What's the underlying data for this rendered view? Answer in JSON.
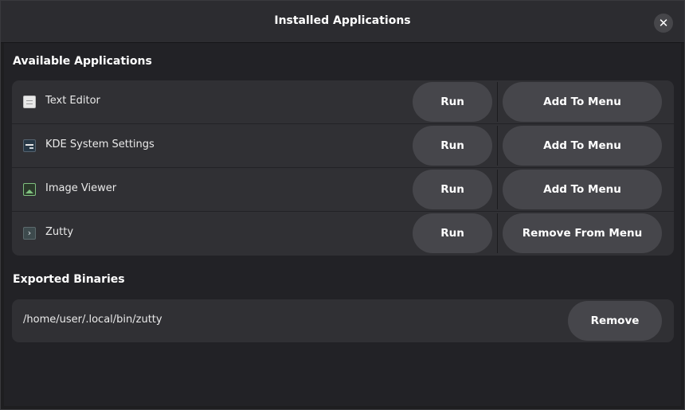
{
  "window": {
    "title": "Installed Applications",
    "close_label": "✕"
  },
  "available": {
    "heading": "Available Applications",
    "apps": [
      {
        "name": "Text Editor",
        "icon": "text-editor-icon",
        "run_label": "Run",
        "menu_label": "Add To Menu"
      },
      {
        "name": "KDE System Settings",
        "icon": "kde-settings-icon",
        "run_label": "Run",
        "menu_label": "Add To Menu"
      },
      {
        "name": "Image Viewer",
        "icon": "image-viewer-icon",
        "run_label": "Run",
        "menu_label": "Add To Menu"
      },
      {
        "name": "Zutty",
        "icon": "terminal-icon",
        "icon_glyph": "›",
        "run_label": "Run",
        "menu_label": "Remove From Menu"
      }
    ]
  },
  "binaries": {
    "heading": "Exported Binaries",
    "items": [
      {
        "path": "/home/user/.local/bin/zutty",
        "remove_label": "Remove"
      }
    ]
  },
  "colors": {
    "background": "#1e1e20",
    "titlebar": "#2c2c30",
    "card": "#303034",
    "button": "#46464b",
    "text": "#ffffff"
  }
}
